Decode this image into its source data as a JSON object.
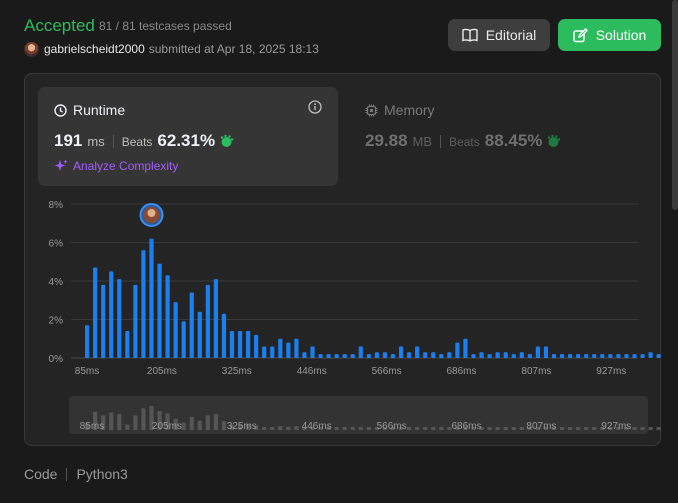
{
  "header": {
    "status": "Accepted",
    "testcases": "81 / 81 testcases passed",
    "username": "gabrielscheidt2000",
    "submitted": "submitted at Apr 18, 2025 18:13",
    "editorial_label": "Editorial",
    "solution_label": "Solution"
  },
  "runtime": {
    "title": "Runtime",
    "value": "191",
    "unit": "ms",
    "beats_label": "Beats",
    "beats_value": "62.31%",
    "analyze_label": "Analyze Complexity"
  },
  "memory": {
    "title": "Memory",
    "value": "29.88",
    "unit": "MB",
    "beats_label": "Beats",
    "beats_value": "88.45%"
  },
  "chart_data": {
    "type": "bar",
    "x_tick_labels": [
      "85ms",
      "205ms",
      "325ms",
      "446ms",
      "566ms",
      "686ms",
      "807ms",
      "927ms"
    ],
    "y_tick_labels": [
      "0%",
      "2%",
      "4%",
      "6%",
      "8%"
    ],
    "ylim": [
      0,
      8
    ],
    "values": [
      1.7,
      4.7,
      3.8,
      4.5,
      4.1,
      1.4,
      3.8,
      5.6,
      6.2,
      4.9,
      4.3,
      2.9,
      1.9,
      3.4,
      2.4,
      3.8,
      4.1,
      2.3,
      1.4,
      1.4,
      1.4,
      1.2,
      0.6,
      0.6,
      1.0,
      0.8,
      1.0,
      0.3,
      0.6,
      0.2,
      0.2,
      0.2,
      0.2,
      0.2,
      0.6,
      0.2,
      0.3,
      0.3,
      0.2,
      0.6,
      0.3,
      0.6,
      0.3,
      0.3,
      0.2,
      0.3,
      0.8,
      1.0,
      0.2,
      0.3,
      0.2,
      0.3,
      0.3,
      0.2,
      0.3,
      0.2,
      0.6,
      0.6,
      0.2,
      0.2,
      0.2,
      0.2,
      0.2,
      0.2,
      0.2,
      0.2,
      0.2,
      0.2,
      0.2,
      0.2,
      0.3,
      0.2,
      0.3,
      0.2
    ],
    "highlight_index": 8,
    "grid": true,
    "bar_color": "#1a7ff0"
  },
  "footer": {
    "code_label": "Code",
    "language": "Python3"
  },
  "colors": {
    "accepted": "#2cbb5d",
    "solution_button": "#2cbb5d",
    "analyze": "#a55bff",
    "bar": "#1a7ff0",
    "beats_icon": "#2cbb5d"
  }
}
